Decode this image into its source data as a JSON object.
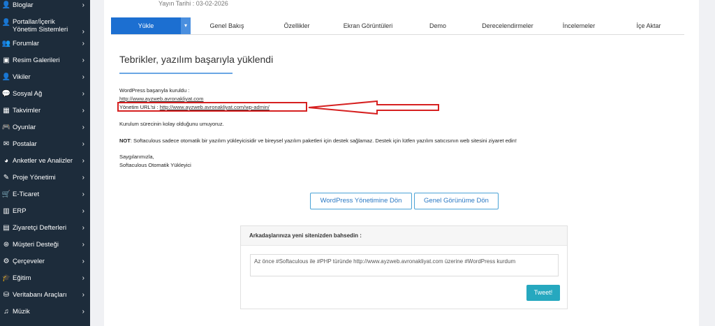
{
  "sidebar": {
    "items": [
      {
        "label": "Bloglar",
        "icon": "user-icon",
        "glyph": "👤"
      },
      {
        "label": "Portallar/İçerik Yönetim Sistemleri",
        "icon": "user-icon",
        "glyph": "👤"
      },
      {
        "label": "Forumlar",
        "icon": "users-icon",
        "glyph": "👥"
      },
      {
        "label": "Resim Galerileri",
        "icon": "image-icon",
        "glyph": "▣"
      },
      {
        "label": "Vikiler",
        "icon": "user-icon",
        "glyph": "👤"
      },
      {
        "label": "Sosyal Ağ",
        "icon": "comments-icon",
        "glyph": "💬"
      },
      {
        "label": "Takvimler",
        "icon": "calendar-icon",
        "glyph": "▦"
      },
      {
        "label": "Oyunlar",
        "icon": "gamepad-icon",
        "glyph": "🎮"
      },
      {
        "label": "Postalar",
        "icon": "envelope-icon",
        "glyph": "✉"
      },
      {
        "label": "Anketler ve Analizler",
        "icon": "pie-chart-icon",
        "glyph": "◕"
      },
      {
        "label": "Proje Yönetimi",
        "icon": "edit-icon",
        "glyph": "✎"
      },
      {
        "label": "E-Ticaret",
        "icon": "shopping-cart-icon",
        "glyph": "🛒"
      },
      {
        "label": "ERP",
        "icon": "bar-chart-icon",
        "glyph": "▥"
      },
      {
        "label": "Ziyaretçi Defterleri",
        "icon": "book-icon",
        "glyph": "▤"
      },
      {
        "label": "Müşteri Desteği",
        "icon": "life-ring-icon",
        "glyph": "⊛"
      },
      {
        "label": "Çerçeveler",
        "icon": "cogs-icon",
        "glyph": "⚙"
      },
      {
        "label": "Eğitim",
        "icon": "graduation-cap-icon",
        "glyph": "🎓"
      },
      {
        "label": "Veritabanı Araçları",
        "icon": "database-icon",
        "glyph": "⛁"
      },
      {
        "label": "Müzik",
        "icon": "music-icon",
        "glyph": "♫"
      }
    ],
    "chevron": "›"
  },
  "header": {
    "date": "Yayın Tarihi : 03-02-2026"
  },
  "tabs": [
    {
      "label": "Yükle"
    },
    {
      "label": "Genel Bakış"
    },
    {
      "label": "Özellikler"
    },
    {
      "label": "Ekran Görüntüleri"
    },
    {
      "label": "Demo"
    },
    {
      "label": "Derecelendirmeler"
    },
    {
      "label": "İncelemeler"
    },
    {
      "label": "İçe Aktar"
    }
  ],
  "tab_dropdown_glyph": "▾",
  "content": {
    "title": "Tebrikler, yazılım başarıyla yüklendi",
    "installed_label": "WordPress başarıyla kuruldu :",
    "site_url": "http://www.ayzweb.avronakliyat.com",
    "admin_label": "Yönetim URL'si :",
    "admin_url": "http://www.ayzweb.avronakliyat.com/wp-admin/",
    "hope_text": "Kurulum sürecinin kolay olduğunu umuyoruz.",
    "note_bold": "NOT",
    "note_text": ": Softaculous sadece otomatik bir yazılım yükleyicisidir ve bireysel yazılım paketleri için destek sağlamaz. Destek için lütfen yazılım satıcısının web sitesini ziyaret edin!",
    "regards": "Saygılarımızla,",
    "signature": "Softaculous Otomatik Yükleyici"
  },
  "buttons": {
    "wp_admin": "WordPress Yönetimine Dön",
    "overview": "Genel Görünüme Dön"
  },
  "share": {
    "title": "Arkadaşlarınıza yeni sitenizden bahsedin :",
    "text": "Az önce #Softaculous ile #PHP türünde http://www.ayzweb.avronakliyat.com üzerine #WordPress kurdum",
    "tweet_label": "Tweet!"
  },
  "colors": {
    "sidebar_bg": "#1d2c3b",
    "accent": "#1c6fd1",
    "annotation_red": "#d62020",
    "tweet": "#26a8bf"
  }
}
